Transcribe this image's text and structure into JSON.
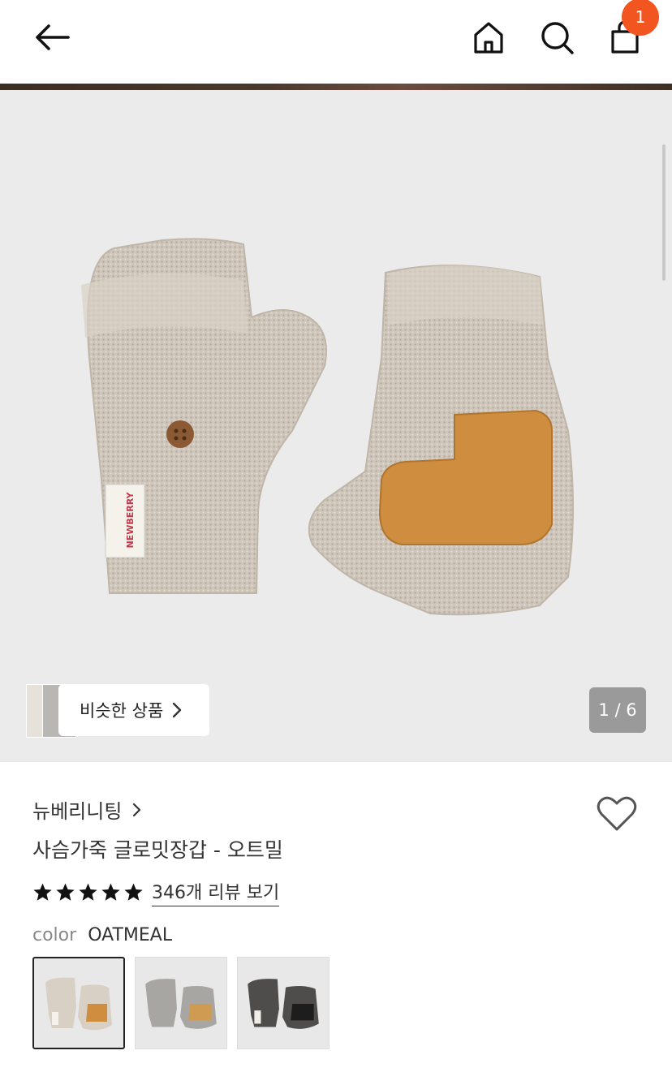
{
  "header": {
    "back_icon": "arrow-left-icon",
    "home_icon": "home-icon",
    "search_icon": "search-icon",
    "bag_icon": "shopping-bag-icon",
    "cart_count": "1",
    "badge_color": "#f2551f"
  },
  "gallery": {
    "similar_label": "비슷한 상품",
    "counter": "1 / 6"
  },
  "product": {
    "brand": "뉴베리니팅",
    "name": "사슴가죽 글로밋장갑 - 오트밀",
    "rating_stars": 5,
    "review_link": "346개 리뷰 보기",
    "color_label": "color",
    "color_value": "OATMEAL",
    "swatches": [
      "oatmeal",
      "gray",
      "charcoal"
    ]
  }
}
